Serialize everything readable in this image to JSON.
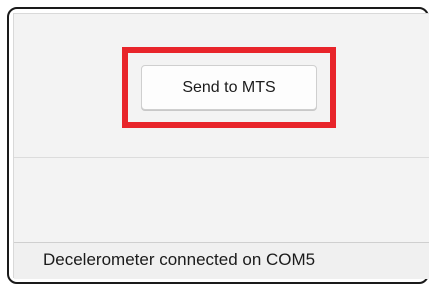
{
  "main": {
    "send_button_label": "Send to MTS"
  },
  "status_bar": {
    "text": "Decelerometer connected on COM5"
  },
  "colors": {
    "highlight": "#e8242a",
    "window_background": "#f3f3f3",
    "status_background": "#f0f0f0"
  }
}
